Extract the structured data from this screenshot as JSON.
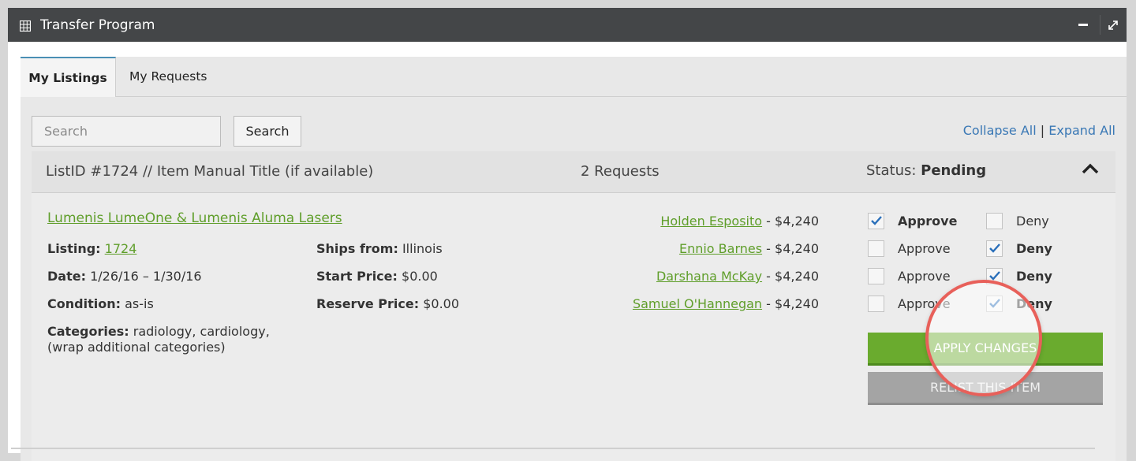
{
  "window": {
    "title": "Transfer Program"
  },
  "tabs": [
    {
      "label": "My Listings",
      "active": true
    },
    {
      "label": "My Requests",
      "active": false
    }
  ],
  "search": {
    "placeholder": "Search",
    "button_label": "Search"
  },
  "links": {
    "collapse_all": "Collapse All",
    "separator": "|",
    "expand_all": "Expand All"
  },
  "listing": {
    "header": {
      "listid_text": "ListID #1724 // Item Manual Title (if available)",
      "requests_text": "2 Requests",
      "status_label": "Status:",
      "status_value": "Pending"
    },
    "title": "Lumenis LumeOne & Lumenis Aluma Lasers",
    "details": {
      "listing_label": "Listing:",
      "listing_value": "1724",
      "date_label": "Date:",
      "date_value": "1/26/16 – 1/30/16",
      "condition_label": "Condition:",
      "condition_value": "as-is",
      "categories_label": "Categories:",
      "categories_value": "radiology, cardiology,",
      "categories_line2": "(wrap additional categories)",
      "ships_label": "Ships from:",
      "ships_value": "Illinois",
      "start_label": "Start Price:",
      "start_value": "$0.00",
      "reserve_label": "Reserve Price:",
      "reserve_value": "$0.00"
    },
    "requests": [
      {
        "name": "Holden Esposito",
        "amount": " - $4,240",
        "approve": true,
        "deny": false
      },
      {
        "name": "Ennio Barnes",
        "amount": " - $4,240",
        "approve": false,
        "deny": true
      },
      {
        "name": "Darshana McKay",
        "amount": " - $4,240",
        "approve": false,
        "deny": true
      },
      {
        "name": "Samuel O'Hannegan",
        "amount": " - $4,240",
        "approve": false,
        "deny": true
      }
    ],
    "approve_label": "Approve",
    "deny_label": "Deny",
    "apply_button": "APPLY CHANGES",
    "relist_button": "RELIST THIS ITEM"
  },
  "colors": {
    "titlebar": "#444648",
    "link_green": "#5f9e2a",
    "link_blue": "#3a78b5",
    "apply_green": "#6aab2e",
    "relist_gray": "#a4a4a4",
    "check_blue": "#2a6fba",
    "highlight_ring": "#e8605a"
  },
  "icons": {
    "title_icon": "table-icon",
    "minimize": "minus-icon",
    "expand": "expand-arrows-icon",
    "collapse": "chevron-up-icon",
    "check": "checkmark-icon"
  }
}
